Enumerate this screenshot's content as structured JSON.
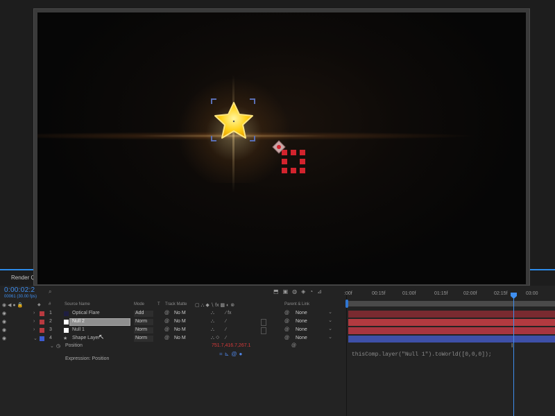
{
  "panel_tabs": {
    "render_queue": "Render Q"
  },
  "timeline": {
    "timecode": "0:00:02:2",
    "timecode_frames": "00061 (30.00 fps)",
    "search_icon": "search-icon",
    "columns": {
      "hash": "#",
      "source_name": "Source Name",
      "mode": "Mode",
      "t": "T",
      "track_matte": "Track Matte",
      "parent_link": "Parent & Link"
    },
    "ruler_ticks": [
      ":00f",
      "00:15f",
      "01:00f",
      "01:15f",
      "02:00f",
      "02:15f",
      "03:00"
    ],
    "layers": [
      {
        "num": "1",
        "name": "Optical Flare",
        "mode": "Add",
        "track_matte": "No M",
        "parent": "None",
        "color": "#b83a40",
        "chip": "#1e1e40"
      },
      {
        "num": "2",
        "name": "Null 2",
        "mode": "Norm",
        "track_matte": "No M",
        "parent": "None",
        "color": "#b83a40",
        "chip": "#ffffff"
      },
      {
        "num": "3",
        "name": "Null 1",
        "mode": "Norm",
        "track_matte": "No M",
        "parent": "None",
        "color": "#b83a40",
        "chip": "#ffffff"
      },
      {
        "num": "4",
        "name": "Shape Layer",
        "mode": "Norm",
        "track_matte": "No M",
        "parent": "None",
        "color": "#3d5bd0",
        "chip": "star"
      }
    ],
    "property": {
      "name": "Position",
      "value": "751.7,416.7,267.1"
    },
    "expression_label": "Expression: Position",
    "expression_code": "thisComp.layer(\"Null 1\").toWorld([0,0,0]);"
  },
  "colors": {
    "accent_blue": "#3f8ff0",
    "null_red": "#d2232d",
    "shape_blue": "#3e50a8"
  }
}
